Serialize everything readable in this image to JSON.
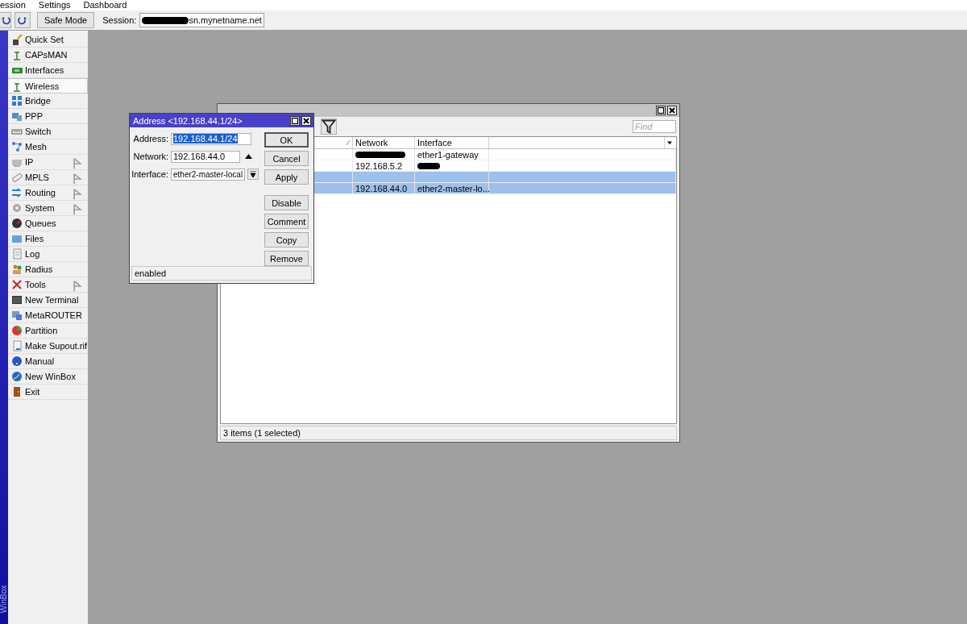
{
  "menu": [
    "ession",
    "Settings",
    "Dashboard"
  ],
  "toolbar": {
    "safe_mode": "Safe Mode",
    "session_label": "Session:",
    "session_value": {
      "redacted": true,
      "text": "sn.mynetname.net"
    }
  },
  "brand": "WinBox",
  "sidebar": {
    "items": [
      {
        "label": "Quick Set",
        "submenu": false,
        "selected": false
      },
      {
        "label": "CAPsMAN",
        "submenu": false,
        "selected": false
      },
      {
        "label": "Interfaces",
        "submenu": false,
        "selected": false
      },
      {
        "label": "Wireless",
        "submenu": false,
        "selected": true
      },
      {
        "label": "Bridge",
        "submenu": false,
        "selected": false
      },
      {
        "label": "PPP",
        "submenu": false,
        "selected": false
      },
      {
        "label": "Switch",
        "submenu": false,
        "selected": false
      },
      {
        "label": "Mesh",
        "submenu": false,
        "selected": false
      },
      {
        "label": "IP",
        "submenu": true,
        "selected": false
      },
      {
        "label": "MPLS",
        "submenu": true,
        "selected": false
      },
      {
        "label": "Routing",
        "submenu": true,
        "selected": false
      },
      {
        "label": "System",
        "submenu": true,
        "selected": false
      },
      {
        "label": "Queues",
        "submenu": false,
        "selected": false
      },
      {
        "label": "Files",
        "submenu": false,
        "selected": false
      },
      {
        "label": "Log",
        "submenu": false,
        "selected": false
      },
      {
        "label": "Radius",
        "submenu": false,
        "selected": false
      },
      {
        "label": "Tools",
        "submenu": true,
        "selected": false
      },
      {
        "label": "New Terminal",
        "submenu": false,
        "selected": false
      },
      {
        "label": "MetaROUTER",
        "submenu": false,
        "selected": false
      },
      {
        "label": "Partition",
        "submenu": false,
        "selected": false
      },
      {
        "label": "Make Supout.rif",
        "submenu": false,
        "selected": false
      },
      {
        "label": "Manual",
        "submenu": false,
        "selected": false
      },
      {
        "label": "New WinBox",
        "submenu": false,
        "selected": false
      },
      {
        "label": "Exit",
        "submenu": false,
        "selected": false
      }
    ]
  },
  "address_list": {
    "find_placeholder": "Find",
    "columns": [
      "Network",
      "Interface"
    ],
    "rows": [
      {
        "selected": false,
        "cells": [
          {
            "redacted": true
          },
          {
            "text": "ether1-gateway"
          }
        ]
      },
      {
        "selected": false,
        "cells": [
          {
            "text": "192.168.5.2"
          },
          {
            "redacted": true
          }
        ]
      },
      {
        "selected": true,
        "cells": [
          {
            "text": ""
          },
          {
            "text": ""
          }
        ]
      },
      {
        "selected": true,
        "cells": [
          {
            "text": "192.168.44.0"
          },
          {
            "text": "ether2-master-lo..."
          }
        ]
      }
    ],
    "status": "3 items (1 selected)"
  },
  "dialog": {
    "title": "Address <192.168.44.1/24>",
    "fields": [
      {
        "label": "Address:",
        "value": "192.168.44.1/24",
        "kind": "selected"
      },
      {
        "label": "Network:",
        "value": "192.168.44.0",
        "kind": "arrow"
      },
      {
        "label": "Interface:",
        "value": "ether2-master-local",
        "kind": "dropdown"
      }
    ],
    "buttons": [
      {
        "label": "OK",
        "default": true
      },
      {
        "label": "Cancel",
        "default": false
      },
      {
        "label": "Apply",
        "default": false
      },
      {
        "label": "Disable",
        "default": false
      },
      {
        "label": "Comment",
        "default": false
      },
      {
        "label": "Copy",
        "default": false
      },
      {
        "label": "Remove",
        "default": false
      }
    ],
    "status": "enabled"
  }
}
